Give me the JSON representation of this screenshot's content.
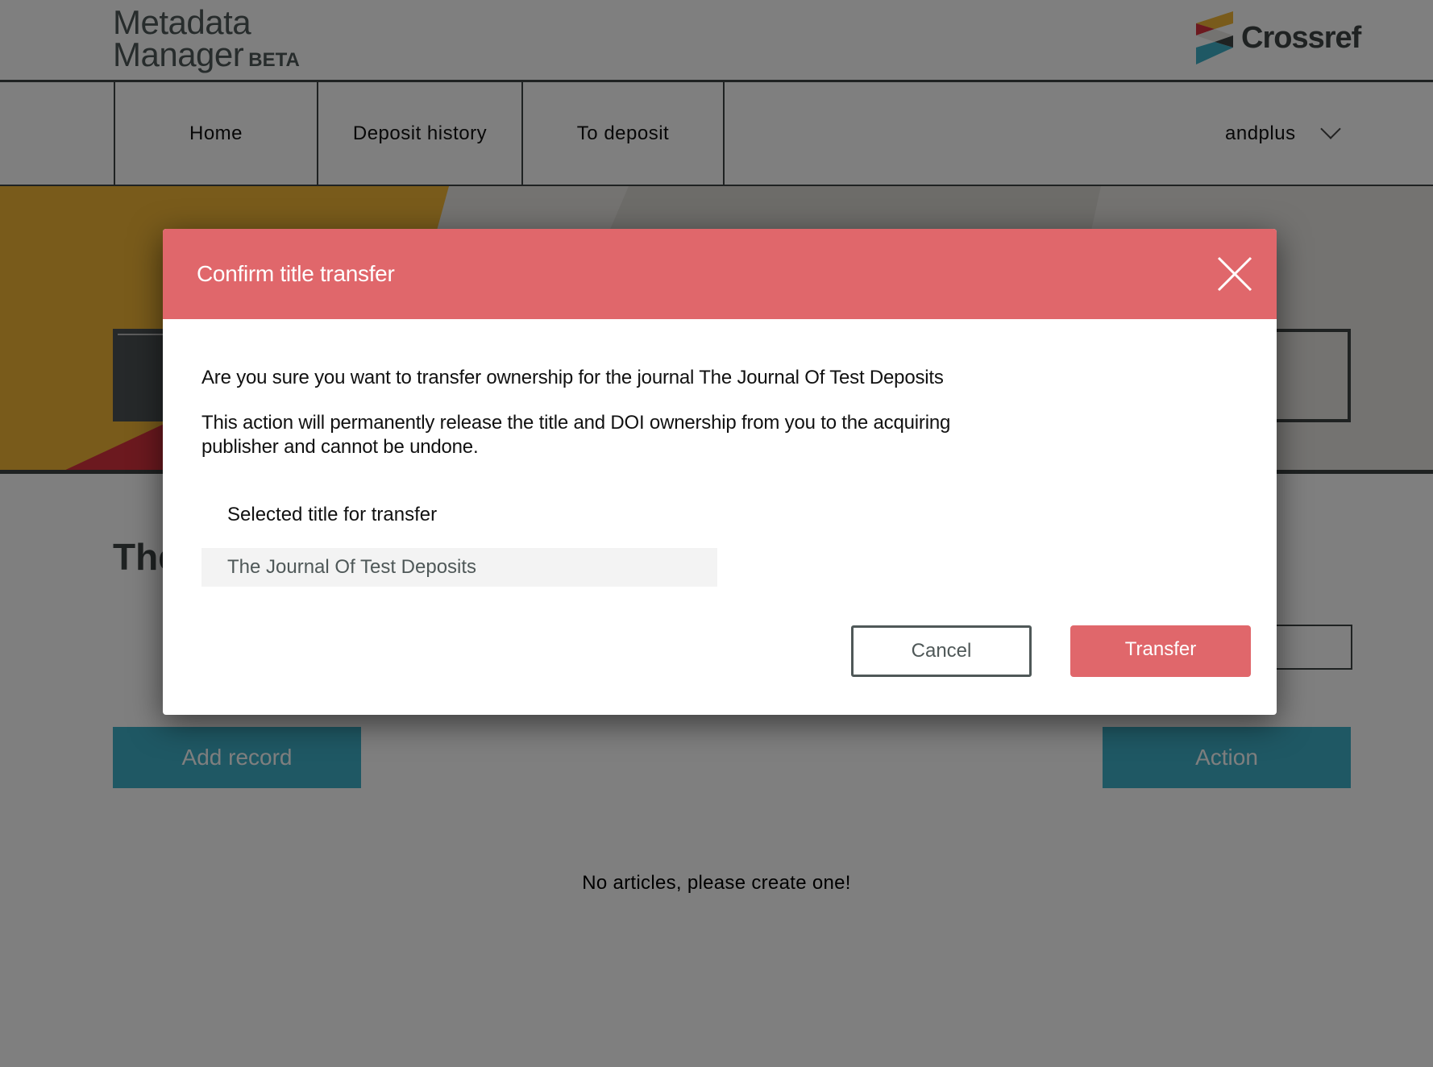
{
  "app": {
    "logo_line1": "Metadata",
    "logo_line2": "Manager",
    "logo_badge": "BETA",
    "brand_name": "Crossref"
  },
  "nav": {
    "items": [
      {
        "label": "Home"
      },
      {
        "label": "Deposit history"
      },
      {
        "label": "To deposit"
      }
    ],
    "user": "andplus"
  },
  "page": {
    "journal_title_visible": "The",
    "add_record_label": "Add record",
    "action_label": "Action",
    "empty_message": "No articles, please create one!"
  },
  "modal": {
    "title": "Confirm title transfer",
    "question": "Are you sure you want to transfer ownership for the journal The Journal Of Test Deposits",
    "warning": "This action will permanently release the title and DOI ownership from you to the acquiring publisher and cannot be undone.",
    "field_label": "Selected title for transfer",
    "field_value": "The Journal Of Test Deposits",
    "cancel_label": "Cancel",
    "transfer_label": "Transfer"
  },
  "colors": {
    "accent_red": "#e0676b",
    "teal": "#3eb1c8",
    "dark": "#3e4545",
    "gold": "#f2b636",
    "crimson": "#d8333f"
  }
}
